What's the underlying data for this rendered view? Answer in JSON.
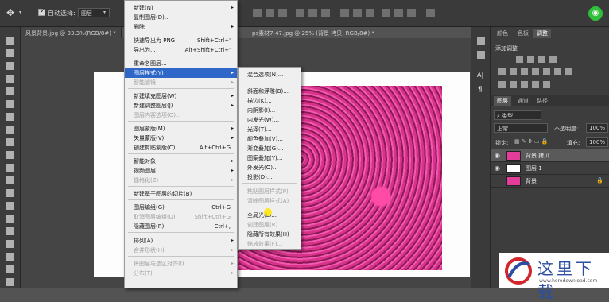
{
  "options_bar": {
    "move_icon": "move-tool-icon",
    "auto_select_label": "自动选择:",
    "auto_select_value": "图层"
  },
  "doc_tabs": [
    {
      "label": "风景背景.jpg @ 33.3%(RGB/8#) *"
    },
    {
      "label": "ps素材7-47.jpg @ 25% (背景 拷贝, RGB/8#) *"
    }
  ],
  "layer_menu": {
    "items": [
      {
        "label": "新建(N)",
        "shortcut": "",
        "arrow": "▸",
        "state": "normal"
      },
      {
        "label": "复制图层(D)...",
        "shortcut": "",
        "arrow": "",
        "state": "normal"
      },
      {
        "label": "删除",
        "shortcut": "",
        "arrow": "▸",
        "state": "normal"
      },
      {
        "label": "快速导出为 PNG",
        "shortcut": "Shift+Ctrl+'",
        "arrow": "",
        "state": "normal"
      },
      {
        "label": "导出为...",
        "shortcut": "Alt+Shift+Ctrl+'",
        "arrow": "",
        "state": "normal"
      },
      {
        "label": "重命名图层...",
        "shortcut": "",
        "arrow": "",
        "state": "normal"
      },
      {
        "label": "图层样式(Y)",
        "shortcut": "",
        "arrow": "▸",
        "state": "selected"
      },
      {
        "label": "智能滤镜",
        "shortcut": "",
        "arrow": "▸",
        "state": "disabled"
      },
      {
        "label": "新建填充图层(W)",
        "shortcut": "",
        "arrow": "▸",
        "state": "normal"
      },
      {
        "label": "新建调整图层(J)",
        "shortcut": "",
        "arrow": "▸",
        "state": "normal"
      },
      {
        "label": "图层内容选项(O)...",
        "shortcut": "",
        "arrow": "",
        "state": "disabled"
      },
      {
        "label": "图层蒙版(M)",
        "shortcut": "",
        "arrow": "▸",
        "state": "normal"
      },
      {
        "label": "矢量蒙版(V)",
        "shortcut": "",
        "arrow": "▸",
        "state": "normal"
      },
      {
        "label": "创建剪贴蒙版(C)",
        "shortcut": "Alt+Ctrl+G",
        "arrow": "",
        "state": "normal"
      },
      {
        "label": "智能对象",
        "shortcut": "",
        "arrow": "▸",
        "state": "normal"
      },
      {
        "label": "视频图层",
        "shortcut": "",
        "arrow": "▸",
        "state": "normal"
      },
      {
        "label": "栅格化(Z)",
        "shortcut": "",
        "arrow": "▸",
        "state": "disabled"
      },
      {
        "label": "新建基于图层的切片(B)",
        "shortcut": "",
        "arrow": "",
        "state": "normal"
      },
      {
        "label": "图层编组(G)",
        "shortcut": "Ctrl+G",
        "arrow": "",
        "state": "normal"
      },
      {
        "label": "取消图层编组(U)",
        "shortcut": "Shift+Ctrl+G",
        "arrow": "",
        "state": "disabled"
      },
      {
        "label": "隐藏图层(R)",
        "shortcut": "Ctrl+,",
        "arrow": "",
        "state": "normal"
      },
      {
        "label": "排列(A)",
        "shortcut": "",
        "arrow": "▸",
        "state": "normal"
      },
      {
        "label": "合并形状(H)",
        "shortcut": "",
        "arrow": "▸",
        "state": "disabled"
      },
      {
        "label": "将图层与选区对齐(I)",
        "shortcut": "",
        "arrow": "▸",
        "state": "disabled"
      },
      {
        "label": "分布(T)",
        "shortcut": "",
        "arrow": "▸",
        "state": "disabled"
      }
    ]
  },
  "style_submenu": {
    "items": [
      {
        "label": "混合选项(N)...",
        "state": "normal"
      },
      {
        "label": "斜面和浮雕(B)...",
        "state": "normal"
      },
      {
        "label": "描边(K)...",
        "state": "normal"
      },
      {
        "label": "内阴影(I)...",
        "state": "normal"
      },
      {
        "label": "内发光(W)...",
        "state": "normal"
      },
      {
        "label": "光泽(T)...",
        "state": "normal"
      },
      {
        "label": "颜色叠加(V)...",
        "state": "normal"
      },
      {
        "label": "渐变叠加(G)...",
        "state": "normal"
      },
      {
        "label": "图案叠加(Y)...",
        "state": "normal"
      },
      {
        "label": "外发光(O)...",
        "state": "normal"
      },
      {
        "label": "投影(D)...",
        "state": "normal"
      },
      {
        "label": "粘贴图层样式(P)",
        "state": "disabled"
      },
      {
        "label": "清除图层样式(A)",
        "state": "disabled"
      },
      {
        "label": "全局光(L)...",
        "state": "normal"
      },
      {
        "label": "创建图层(R)",
        "state": "disabled"
      },
      {
        "label": "隐藏所有效果(H)",
        "state": "normal"
      },
      {
        "label": "缩放效果(F)...",
        "state": "disabled"
      }
    ]
  },
  "adjustments_panel": {
    "tabs": [
      "颜色",
      "色板",
      "调整"
    ],
    "add_label": "添加调整"
  },
  "layers_panel": {
    "tabs": [
      "图层",
      "通道",
      "路径"
    ],
    "kind_label": "类型",
    "blend_mode": "正常",
    "opacity_label": "不透明度:",
    "opacity_value": "100%",
    "lock_label": "锁定:",
    "fill_label": "填充:",
    "fill_value": "100%",
    "layers": [
      {
        "name": "背景 拷贝",
        "selected": true,
        "thumb": "flowers"
      },
      {
        "name": "图层 1",
        "selected": false,
        "thumb": "white"
      },
      {
        "name": "背景",
        "selected": false,
        "thumb": "flowers"
      }
    ]
  },
  "watermark": {
    "text": "这里下载",
    "url": "www.herodownload.com"
  },
  "colors": {
    "menu_highlight": "#2f67c9",
    "flower_pink": "#e23d98",
    "bg_dark": "#535353"
  }
}
